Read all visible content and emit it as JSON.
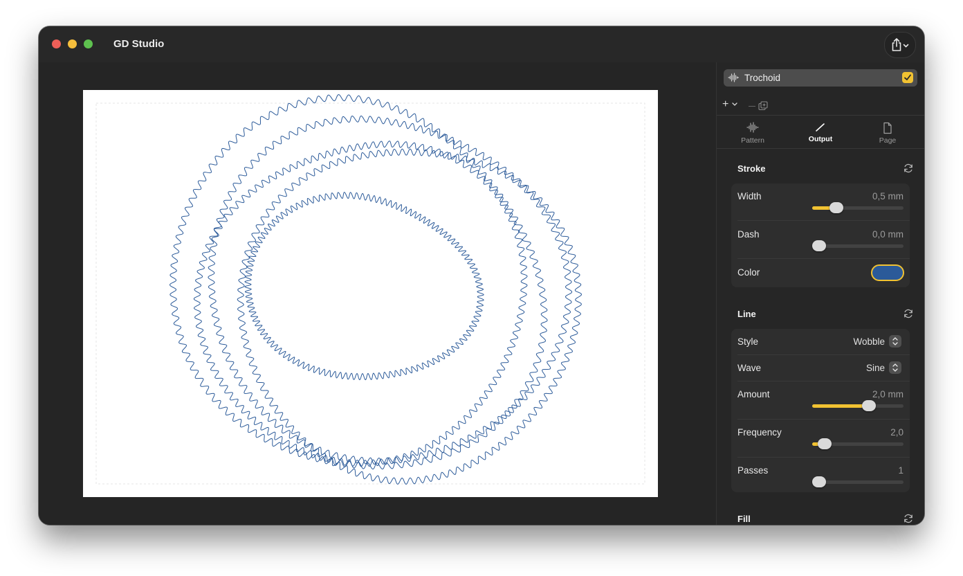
{
  "window": {
    "title": "GD Studio"
  },
  "layer": {
    "name": "Trochoid",
    "enabled": true,
    "icon": "waveform-icon"
  },
  "tabs": [
    {
      "label": "Pattern",
      "icon": "waveform-icon"
    },
    {
      "label": "Output",
      "icon": "pen-line-icon"
    },
    {
      "label": "Page",
      "icon": "document-icon"
    }
  ],
  "active_tab": "Output",
  "stroke": {
    "title": "Stroke",
    "width": {
      "label": "Width",
      "value": "0,5 mm",
      "level": 0.22
    },
    "dash": {
      "label": "Dash",
      "value": "0,0 mm",
      "level": 0.0
    },
    "color": {
      "label": "Color",
      "hex": "#2b5a99"
    }
  },
  "line": {
    "title": "Line",
    "style": {
      "label": "Style",
      "value": "Wobble"
    },
    "wave": {
      "label": "Wave",
      "value": "Sine"
    },
    "amount": {
      "label": "Amount",
      "value": "2,0 mm",
      "level": 0.64
    },
    "frequency": {
      "label": "Frequency",
      "value": "2,0",
      "level": 0.07
    },
    "passes": {
      "label": "Passes",
      "value": "1",
      "level": 0.0
    }
  },
  "fill": {
    "title": "Fill"
  },
  "colors": {
    "accent": "#f1c232",
    "stroke": "#2b5a99"
  }
}
